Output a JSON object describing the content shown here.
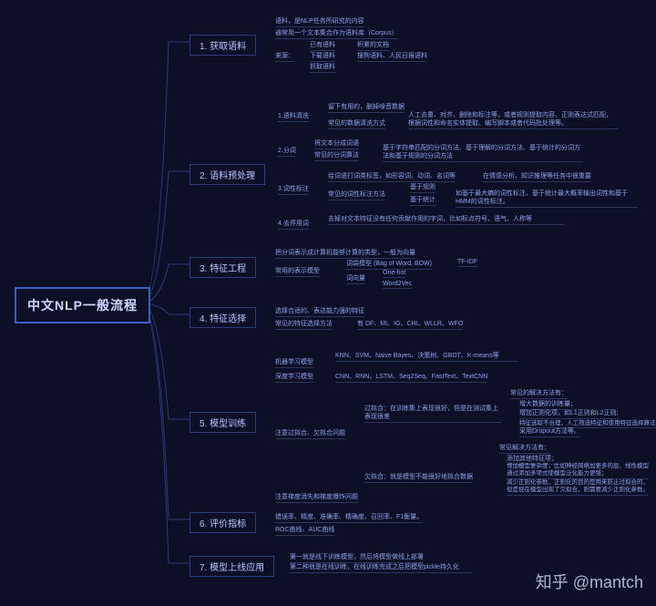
{
  "root": "中文NLP一般流程",
  "watermark": "知乎 @mantch",
  "steps": {
    "s1": {
      "label": "1.  获取语料",
      "a": "语料，是NLP任务所研究的内容",
      "b": "通常用一个文本集合作为语料库（Corpus）",
      "c": "来源：",
      "c1": "已有语料",
      "c2": "积累的文档",
      "c3": "下载语料",
      "c4": "搜狗语料、人民日报语料",
      "c5": "抓取语料"
    },
    "s2": {
      "label": "2.  语料预处理",
      "p1": "1.语料清洗",
      "p1a": "留下有用的，删掉噪音数据",
      "p1b": "常见的数据清洗方式",
      "p1b1": "人工去重、对齐、删除和标注等，或者规则提取内容、正则表达式匹配，根据词性和命名实体提取、编写脚本或者代码批处理等。",
      "p2": "2.分词",
      "p2a": "将文本分成词语",
      "p2b": "常见的分词算法",
      "p2b1": "基于字符串匹配的分词方法、基于理解的分词方法、基于统计的分词方法和基于规则的分词方法",
      "p3": "3.词性标注",
      "p3a": "给词语打词类标签，如形容词、动词、名词等",
      "p3a1": "在情感分析、知识推理等任务中很重要",
      "p3b": "常见的词性标注方法",
      "p3b1": "基于规则",
      "p3b2": "基于统计",
      "p3b2a": "如基于最大熵的词性标注、基于统计最大概率输出词性和基于HMM的词性标注。",
      "p4": "4.去停用词",
      "p4a": "去掉对文本特征没有任何贡献作用的字词，比如标点符号、语气、人称等"
    },
    "s3": {
      "label": "3.  特征工程",
      "a": "把分词表示成计算机能够计算的类型，一般为向量",
      "b": "常用的表示模型",
      "b1": "词袋模型 (Bag of Word, BOW)",
      "b2": "TF-IDF",
      "b3": "词向量",
      "b3a": "One-hot",
      "b3b": "Word2Vec"
    },
    "s4": {
      "label": "4.  特征选择",
      "a": "选择合适的、表达能力强的特征",
      "b": "常见的特征选择方法",
      "b1": "有 DF、MI、IG、CHI、WLLR、WFO"
    },
    "s5": {
      "label": "5.  模型训练",
      "a": "机器学习模型",
      "a1": "KNN、SVM、Naive Bayes、决策树、GBDT、K-means等",
      "b": "深度学习模型",
      "b1": "CNN、RNN、LSTM、Seq2Seq、FastText、TextCNN",
      "c": "注意过拟合、欠拟合问题",
      "c1": "过拟合：在训练集上表现很好，但是在测试集上表现很差",
      "c1h": "常见的解决方法有：",
      "c1a": "增大数据的训练量；",
      "c1b": "增加正则化项，如L1正则和L2正则;",
      "c1c": "特征选取不合理，人工筛选特征和使用特征选择算法;",
      "c1d": "采用Dropout方法等。",
      "c2": "欠拟合：就是模型不能很好地拟合数据",
      "c2h": "常见解决方法有：",
      "c2a": "添加其他特征项；",
      "c2b": "增加模型复杂度，比如神经网络加更多的层、线性模型通过添加多项式使模型泛化能力更强；",
      "c2c": "减少正则化参数，正则化的目的是用来防止过拟合的，但是现在模型出现了欠拟合，则需要减少正则化参数。",
      "d": "注意梯度消失和梯度爆炸问题"
    },
    "s6": {
      "label": "6.  评价指标",
      "a": "错误率、精度、准确率、精确度、召回率、F1衡量。",
      "b": "ROC曲线、AUC曲线"
    },
    "s7": {
      "label": "7.  模型上线应用",
      "a": "第一就是线下训练模型，然后将模型做线上部署",
      "b": "第二种就是在线训练，在线训练完成之后把模型pickle持久化"
    }
  }
}
